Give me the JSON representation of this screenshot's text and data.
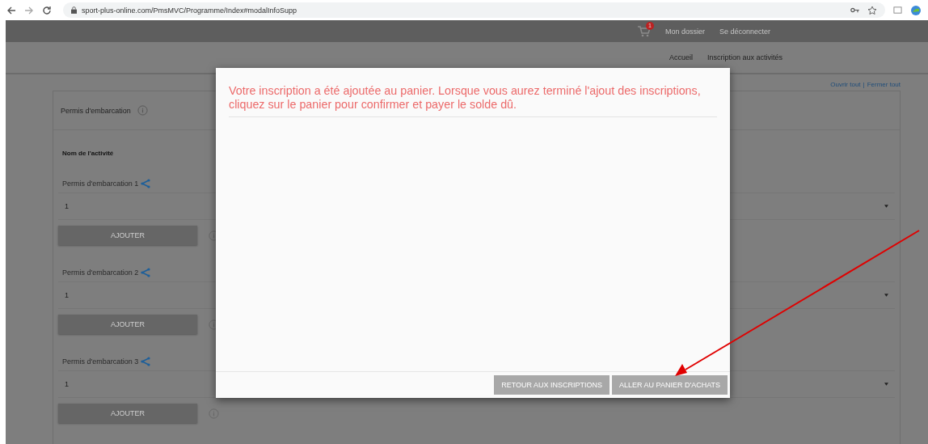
{
  "browser": {
    "url": "sport-plus-online.com/PmsMVC/Programme/Index#modalInfoSupp"
  },
  "header": {
    "cart_count": "1",
    "links": [
      "Mon dossier",
      "Se déconnecter"
    ]
  },
  "nav": {
    "items": [
      "Accueil",
      "Inscription aux activités"
    ]
  },
  "toggle_links": {
    "items": [
      "Ouvrir tout",
      "Fermer tout"
    ],
    "separator": "|"
  },
  "section": {
    "title": "Permis d'embarcation",
    "column_header": "Nom de l'activité",
    "activities": [
      {
        "name": "Permis d'embarcation 1",
        "quantity": "1",
        "button": "AJOUTER"
      },
      {
        "name": "Permis d'embarcation 2",
        "quantity": "1",
        "button": "AJOUTER"
      },
      {
        "name": "Permis d'embarcation 3",
        "quantity": "1",
        "button": "AJOUTER"
      }
    ]
  },
  "modal": {
    "message": "Votre inscription a été ajoutée au panier. Lorsque vous aurez terminé l'ajout des inscriptions, cliquez sur le panier pour confirmer et payer le solde dû.",
    "buttons": [
      "RETOUR AUX INSCRIPTIONS",
      "ALLER AU PANIER D'ACHATS"
    ]
  }
}
